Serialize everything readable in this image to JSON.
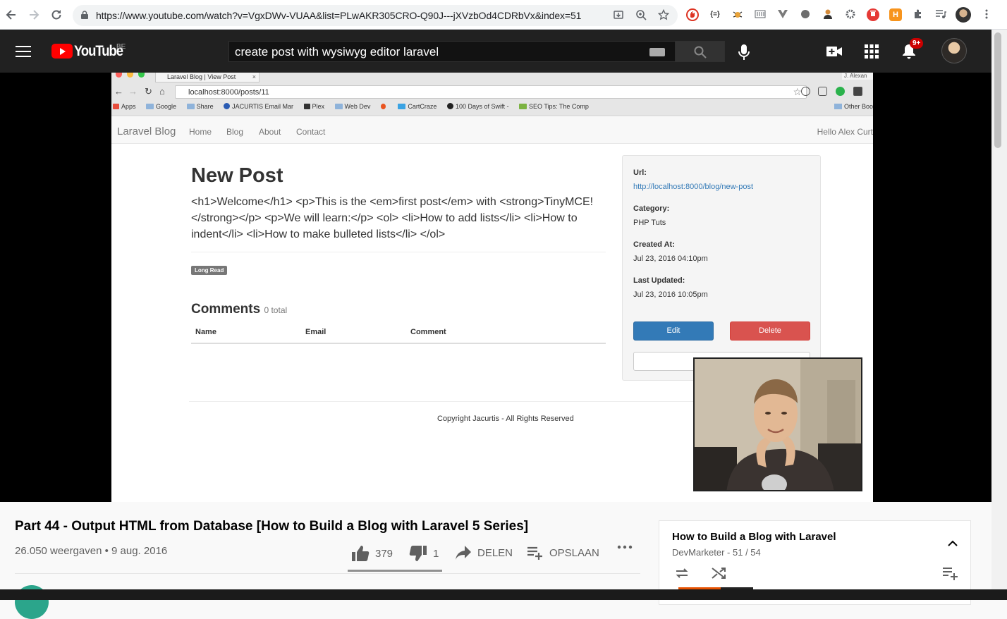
{
  "browser": {
    "url": "https://www.youtube.com/watch?v=VgxDWv-VUAA&list=PLwAKR305CRO-Q90J---jXVzbOd4CDRbVx&index=51",
    "extensions": [
      "H"
    ]
  },
  "masthead": {
    "logo_text": "YouTube",
    "country_code": "BE",
    "search_value": "create post with wysiwyg editor laravel",
    "notification_count": "9+"
  },
  "video_frame": {
    "tab_title": "Laravel Blog | View Post",
    "tab_close": "×",
    "user_chip": "J. Alexan",
    "address": "localhost:8000/posts/11",
    "bookmarks": [
      "Apps",
      "Google",
      "Share",
      "JACURTIS Email Mar",
      "Plex",
      "Web Dev",
      "CartCraze",
      "100 Days of Swift -",
      "SEO Tips: The Comp"
    ],
    "other_bookmarks": "Other Boo",
    "site_brand": "Laravel Blog",
    "site_nav": [
      "Home",
      "Blog",
      "About",
      "Contact"
    ],
    "greeting": "Hello Alex Curt",
    "post_title": "New Post",
    "post_body": "<h1>Welcome</h1> <p>This is the <em>first post</em> with <strong>TinyMCE!</strong></p> <p>We will learn:</p> <ol> <li>How to add lists</li> <li>How to indent</li> <li>How to make bulleted lists</li> </ol>",
    "tag": "Long Read",
    "comments_heading": "Comments",
    "comments_total": "0 total",
    "table_headers": [
      "Name",
      "Email",
      "Comment"
    ],
    "details": {
      "url_label": "Url:",
      "url_value": "http://localhost:8000/blog/new-post",
      "category_label": "Category:",
      "category_value": "PHP Tuts",
      "created_label": "Created At:",
      "created_value": "Jul 23, 2016 04:10pm",
      "updated_label": "Last Updated:",
      "updated_value": "Jul 23, 2016 10:05pm"
    },
    "edit_label": "Edit",
    "delete_label": "Delete",
    "copyright": "Copyright Jacurtis - All Rights Reserved"
  },
  "video": {
    "title": "Part 44 - Output HTML from Database [How to Build a Blog with Laravel 5 Series]",
    "views": "26.050 weergaven • 9 aug. 2016",
    "likes": "379",
    "dislikes": "1",
    "share_label": "DELEN",
    "save_label": "OPSLAAN",
    "more_label": "..."
  },
  "playlist": {
    "title": "How to Build a Blog with Laravel",
    "owner": "DevMarketer",
    "position": "51 / 54"
  }
}
